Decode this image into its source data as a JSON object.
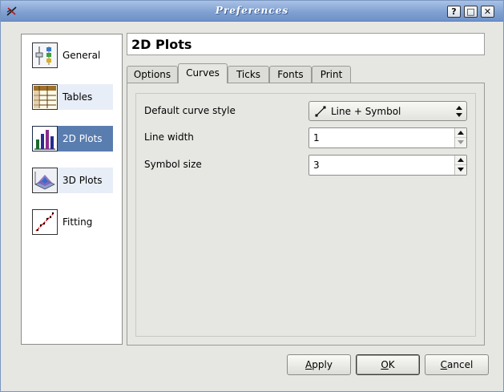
{
  "window": {
    "title": "Preferences"
  },
  "titlebar_buttons": [
    {
      "name": "help",
      "glyph": "?"
    },
    {
      "name": "maximize",
      "glyph": "□"
    },
    {
      "name": "close",
      "glyph": "✕"
    }
  ],
  "sidebar": {
    "items": [
      {
        "label": "General",
        "icon": "general-settings-icon"
      },
      {
        "label": "Tables",
        "icon": "table-icon"
      },
      {
        "label": "2D Plots",
        "icon": "bar-chart-icon",
        "selected": true
      },
      {
        "label": "3D Plots",
        "icon": "surface-plot-icon"
      },
      {
        "label": "Fitting",
        "icon": "fitting-icon"
      }
    ]
  },
  "panel": {
    "title": "2D Plots"
  },
  "tabs": [
    {
      "label": "Options"
    },
    {
      "label": "Curves",
      "active": true
    },
    {
      "label": "Ticks"
    },
    {
      "label": "Fonts"
    },
    {
      "label": "Print"
    }
  ],
  "curves": {
    "default_style_label": "Default curve style",
    "default_style_value": "Line + Symbol",
    "line_width_label": "Line width",
    "line_width_value": "1",
    "symbol_size_label": "Symbol size",
    "symbol_size_value": "3"
  },
  "buttons": {
    "apply": {
      "mnemonic": "A",
      "rest": "pply"
    },
    "ok": {
      "mnemonic": "O",
      "rest": "K"
    },
    "cancel": {
      "mnemonic": "C",
      "rest": "ancel"
    }
  },
  "colors": {
    "selection": "#5a7db0",
    "titlebar": "#7e9fd0"
  }
}
